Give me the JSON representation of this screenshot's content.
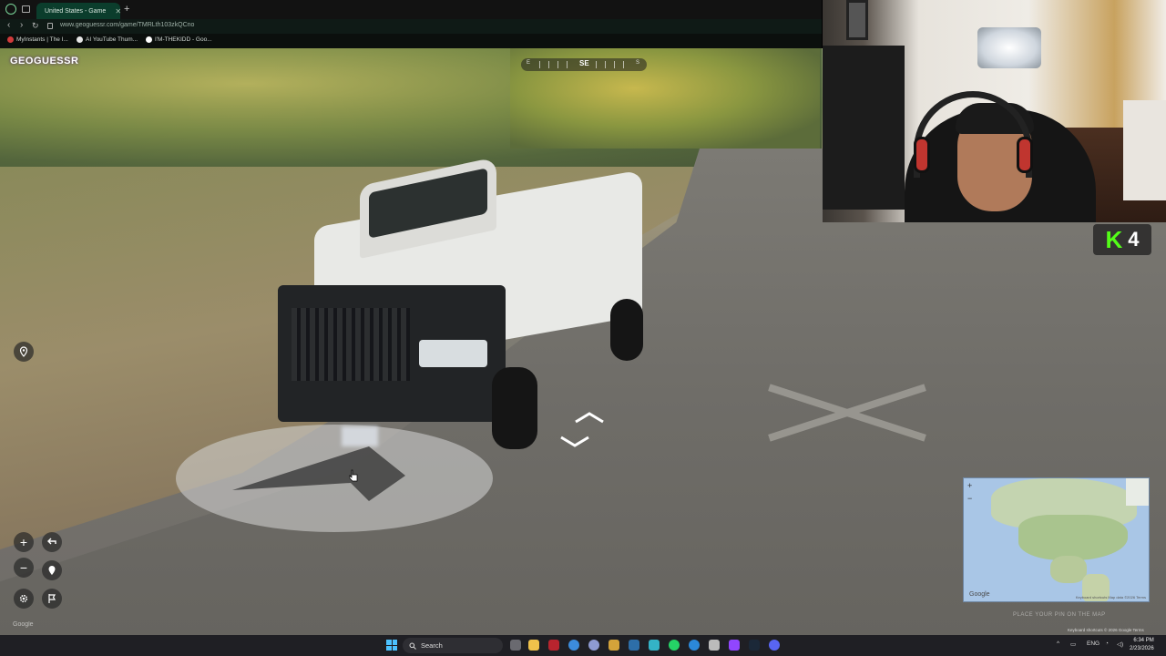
{
  "browser": {
    "tab_title": "United States - Game",
    "url": "www.geoguessr.com/game/TMRLth103zkQCno",
    "new_tab": "+",
    "bookmarks": [
      {
        "label": "MyInstants | The I...",
        "color": "#d13b3b"
      },
      {
        "label": "AI YouTube Thum...",
        "color": "#e6e6e6"
      },
      {
        "label": "I'M-THEKIDD - Goo...",
        "color": "#ffffff"
      }
    ]
  },
  "game": {
    "logo": "GEOGUESSR",
    "compass": {
      "heading": "SE",
      "marks": [
        "E",
        "S"
      ]
    },
    "controls": {
      "zoom_in": "+",
      "zoom_out": "−"
    },
    "place_guess": "PLACE YOUR PIN ON THE MAP",
    "google_watermark": "Google",
    "map": {
      "zoom_in": "+",
      "zoom_out": "−",
      "google": "Google",
      "attribution": "Keyboard shortcuts  Map data ©2026  Terms"
    },
    "sv_attribution": "Keyboard shortcuts  © 2026 Google  Terms"
  },
  "overlay": {
    "kick_letter": "K",
    "viewer_count": "4"
  },
  "taskbar": {
    "search_label": "Search",
    "tray_lang": "ENG",
    "time": "6:34 PM",
    "date": "2/23/2026"
  },
  "colors": {
    "accent": "#0b3d2c",
    "kick_green": "#53fc18",
    "logo_purple": "#c13bd0"
  }
}
